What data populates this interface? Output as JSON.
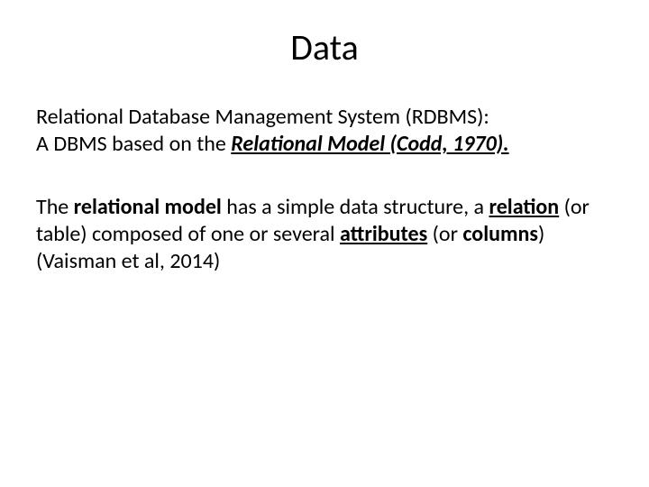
{
  "slide": {
    "title": "Data",
    "para1": {
      "t1": "Relational Database Management System (RDBMS):",
      "t2": "A DBMS based on the ",
      "t3": "Relational Model (Codd, 1970).",
      "t4": ""
    },
    "para2": {
      "t1": "The ",
      "t2": "relational model",
      "t3": " has a simple data structure, a ",
      "t4": "relation",
      "t5": " (or table) composed of one or several ",
      "t6": "attributes",
      "t7": " (or ",
      "t8": "columns",
      "t9": ") (Vaisman et al, 2014)"
    }
  }
}
